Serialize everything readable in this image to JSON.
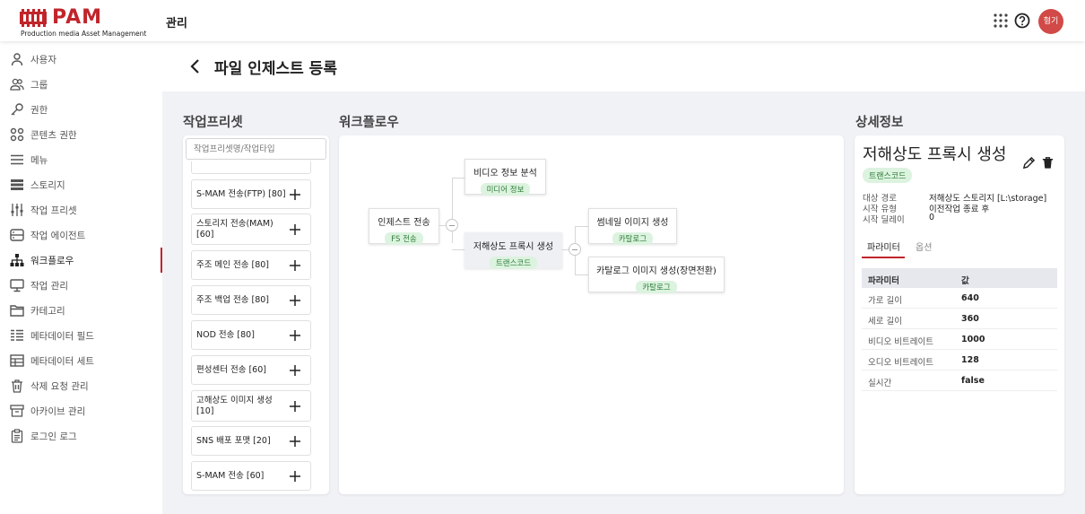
{
  "header": {
    "logo_text": "PAM",
    "logo_subtitle": "Production media Asset Management",
    "title": "관리",
    "avatar_initials": "형기",
    "brand_color": "#c0252b"
  },
  "sidebar": {
    "items": [
      {
        "label": "사용자",
        "icon": "user-icon"
      },
      {
        "label": "그룹",
        "icon": "group-icon"
      },
      {
        "label": "권한",
        "icon": "key-icon"
      },
      {
        "label": "콘텐츠 권한",
        "icon": "grid-icon"
      },
      {
        "label": "메뉴",
        "icon": "menu-icon"
      },
      {
        "label": "스토리지",
        "icon": "storage-icon"
      },
      {
        "label": "작업 프리셋",
        "icon": "sliders-icon"
      },
      {
        "label": "작업 에이전트",
        "icon": "agent-icon"
      },
      {
        "label": "워크플로우",
        "icon": "workflow-icon",
        "active": true
      },
      {
        "label": "작업 관리",
        "icon": "monitor-icon"
      },
      {
        "label": "카테고리",
        "icon": "folder-icon"
      },
      {
        "label": "메타데이터 필드",
        "icon": "fields-icon"
      },
      {
        "label": "메타데이터 세트",
        "icon": "table-icon"
      },
      {
        "label": "삭제 요청 관리",
        "icon": "trash-icon"
      },
      {
        "label": "아카이브 관리",
        "icon": "archive-icon"
      },
      {
        "label": "로그인 로그",
        "icon": "clipboard-icon"
      }
    ]
  },
  "page": {
    "title": "파일 인제스트 등록"
  },
  "presets": {
    "section_title": "작업프리셋",
    "search_placeholder": "작업프리셋명/작업타입",
    "items": [
      "S-MAM 전송(FTP) [80]",
      "스토리지 전송(MAM) [60]",
      "주조 메인 전송 [80]",
      "주조 백업 전송 [80]",
      "NOD 전송 [80]",
      "편성센터 전송 [60]",
      "고해상도 이미지 생성 [10]",
      "SNS 배포 포맷 [20]",
      "S-MAM 전송 [60]"
    ]
  },
  "workflow": {
    "section_title": "워크플로우",
    "nodes": {
      "ingest": {
        "title": "인제스트 전송",
        "tag": "FS 전송"
      },
      "video_info": {
        "title": "비디오 정보 분석",
        "tag": "미디어 정보"
      },
      "proxy": {
        "title": "저해상도 프록시 생성",
        "tag": "트랜스코드"
      },
      "thumbnail": {
        "title": "썸네일 이미지 생성",
        "tag": "카탈로그"
      },
      "catalog": {
        "title": "카탈로그 이미지 생성(장면전환)",
        "tag": "카탈로그"
      }
    }
  },
  "detail": {
    "section_title": "상세정보",
    "title": "저해상도 프록시 생성",
    "tag": "트랜스코드",
    "info": [
      {
        "key": "대상 경로",
        "value": "저해상도 스토리지 [L:\\storage]"
      },
      {
        "key": "시작 유형",
        "value": "이전작업 종료 후"
      },
      {
        "key": "시작 딜레이",
        "value": "0"
      }
    ],
    "tabs": [
      "파라미터",
      "옵션"
    ],
    "params_header": {
      "name": "파라미터",
      "value": "값"
    },
    "params": [
      {
        "name": "가로 길이",
        "value": "640"
      },
      {
        "name": "세로 길이",
        "value": "360"
      },
      {
        "name": "비디오 비트레이트",
        "value": "1000"
      },
      {
        "name": "오디오 비트레이트",
        "value": "128"
      },
      {
        "name": "실시간",
        "value": "false"
      }
    ]
  }
}
